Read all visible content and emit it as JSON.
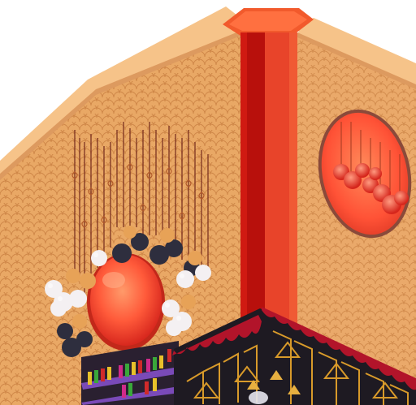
{
  "scene": {
    "type": "isometric-room-corner",
    "palette": {
      "wall_scales": "#e9a865",
      "wall_scales_dark": "#d68a4c",
      "wall_trim": "#f6c389",
      "wall_trim_shadow": "#e2a36a",
      "pillar_left": "#c4140f",
      "pillar_right": "#e8442a",
      "pillar_top": "#f25a2c",
      "window_glow": "#ff6a4a",
      "window_rim": "#8a4a3a",
      "bulb_dark": "#2e2e3e",
      "bulb_white": "#f4f0f2",
      "bulb_amber": "#e7a257",
      "wire": "#7a3020",
      "bar_dark": "#1e1a22",
      "deco_gold": "#d89a2a",
      "curtain_red": "#b2142a",
      "shelf_purple": "#7a4ab8"
    },
    "objects": [
      {
        "name": "left-wall",
        "icon": "scale-pattern-wall"
      },
      {
        "name": "right-wall",
        "icon": "scale-pattern-wall"
      },
      {
        "name": "corner-pillar",
        "icon": "red-pillar"
      },
      {
        "name": "round-window",
        "icon": "oval-window"
      },
      {
        "name": "hanging-lamp-cluster",
        "icon": "bulb-chandelier"
      },
      {
        "name": "glowing-orb-panel",
        "icon": "orange-orb"
      },
      {
        "name": "bottle-shelf",
        "icon": "bottles"
      },
      {
        "name": "art-deco-bar",
        "icon": "art-deco-panel"
      }
    ]
  }
}
